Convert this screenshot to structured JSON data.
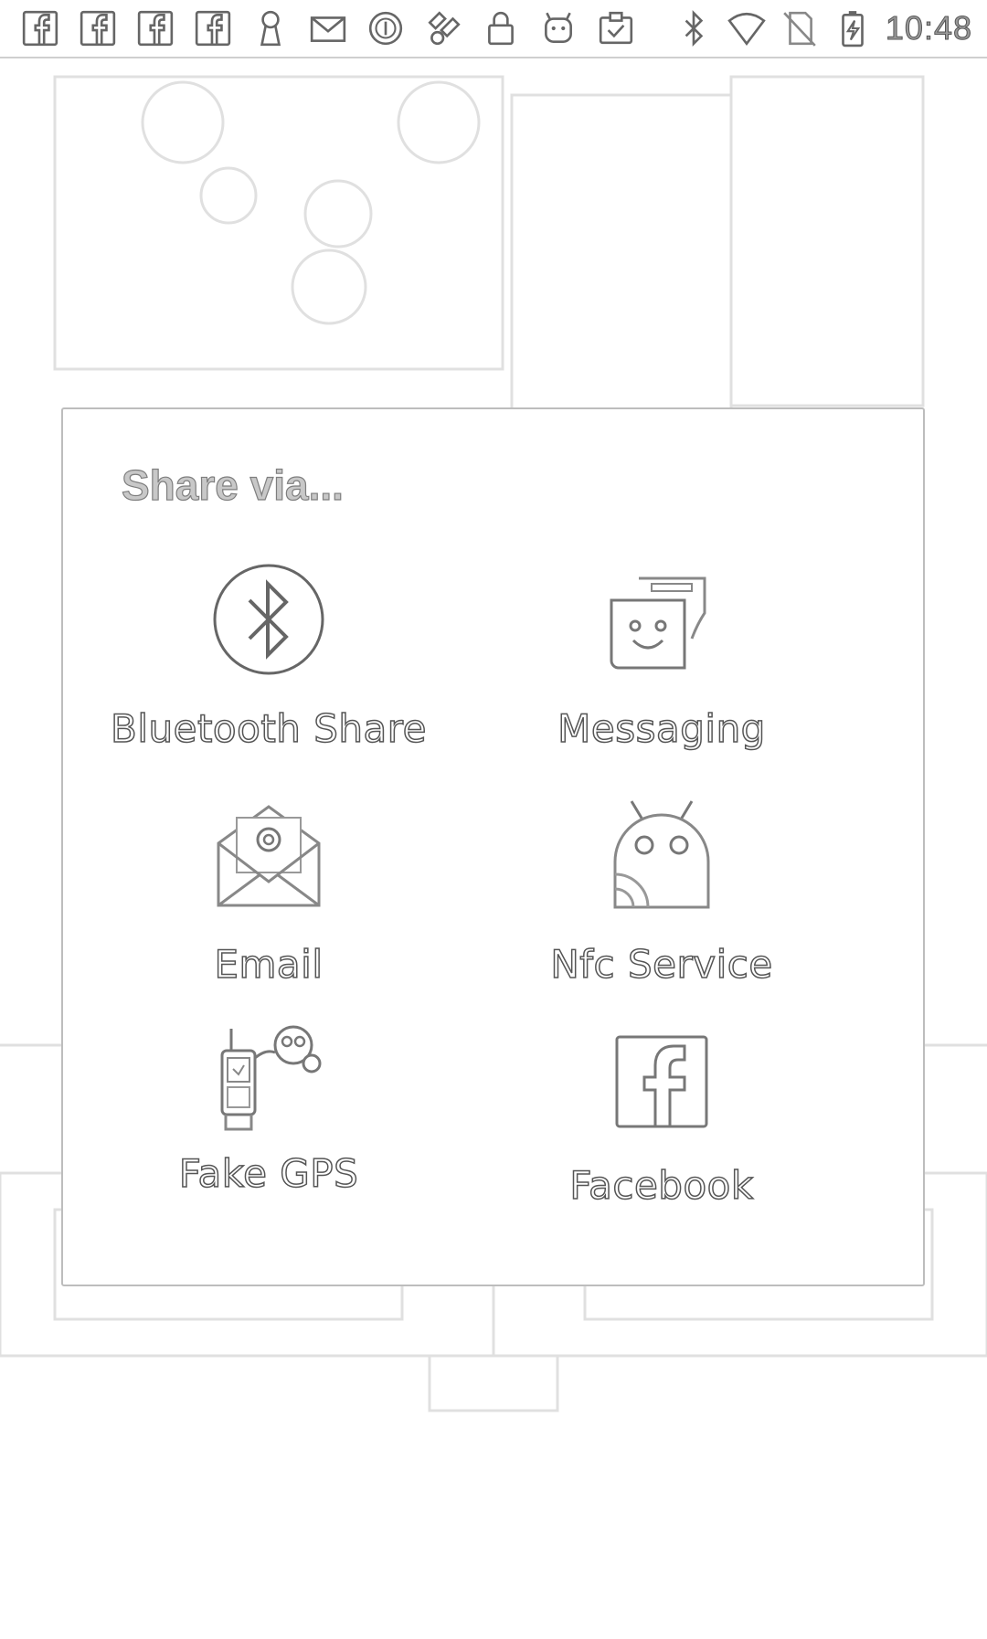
{
  "status_bar": {
    "left_icons": [
      "facebook-icon",
      "facebook-icon",
      "facebook-icon",
      "facebook-icon",
      "keyhole-icon",
      "mail-icon",
      "coin-icon",
      "fake-gps-icon",
      "lock-icon",
      "android-icon",
      "clipboard-check-icon"
    ],
    "right_icons": [
      "bluetooth-icon",
      "wifi-icon",
      "no-sim-icon",
      "battery-charging-icon"
    ],
    "time": "10:48"
  },
  "dialog": {
    "title": "Share via...",
    "items": [
      {
        "label": "Bluetooth Share",
        "icon": "bluetooth-share-icon"
      },
      {
        "label": "Messaging",
        "icon": "messaging-icon"
      },
      {
        "label": "Email",
        "icon": "email-icon"
      },
      {
        "label": "Nfc Service",
        "icon": "nfc-service-icon"
      },
      {
        "label": "Fake GPS",
        "icon": "fake-gps-app-icon"
      },
      {
        "label": "Facebook",
        "icon": "facebook-app-icon"
      }
    ]
  },
  "colors": {
    "background": "#ffffff",
    "outline": "#555555",
    "dialog_border": "#bdbdbd"
  }
}
